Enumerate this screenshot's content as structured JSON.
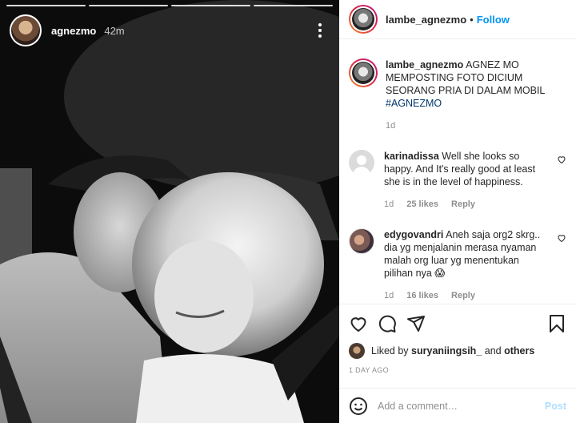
{
  "story": {
    "username": "agnezmo",
    "time": "42m",
    "segments": 4
  },
  "post": {
    "username": "lambe_agnezmo",
    "separator": "•",
    "follow_label": "Follow",
    "caption": {
      "username": "lambe_agnezmo",
      "text": "AGNEZ MO MEMPOSTING FOTO DICIUM SEORANG PRIA DI DALAM MOBIL",
      "hashtag": "#AGNEZMO",
      "age": "1d"
    },
    "comments": [
      {
        "username": "karinadissa",
        "text": "Well she looks so happy. And It's really good at least she is in the level of happiness.",
        "age": "1d",
        "likes": "25 likes",
        "reply": "Reply"
      },
      {
        "username": "edygovandri",
        "text": "Aneh saja org2 skrg.. dia yg menjalanin merasa nyaman malah org luar yg menentukan pilihan nya 😱",
        "age": "1d",
        "likes": "16 likes",
        "reply": "Reply"
      }
    ],
    "liked_by": {
      "prefix": "Liked by",
      "user": "suryaniingsih_",
      "connector": "and",
      "others": "others"
    },
    "date": "1 DAY AGO",
    "add_comment_placeholder": "Add a comment…",
    "post_label": "Post"
  },
  "colors": {
    "accent": "#0095f6",
    "post_disabled": "#b2dffc",
    "hashtag": "#00376b",
    "muted": "#8e8e8e"
  }
}
